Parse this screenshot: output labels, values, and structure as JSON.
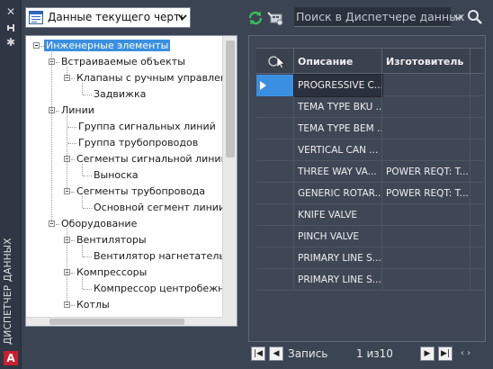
{
  "palette": {
    "title": "ДИСПЕТЧЕР ДАННЫХ",
    "close_icon": "close-icon",
    "pin_icon": "pin-icon",
    "settings_icon": "gear-icon",
    "app_logo_text": "A"
  },
  "toolbar": {
    "data_source_selected": "Данные текущего чертежа",
    "refresh_icon": "refresh-icon",
    "export_icon": "export-icon",
    "search_placeholder": "Поиск в Диспетчере данных"
  },
  "tree": {
    "nodes": [
      {
        "label": "Инженерные элементы",
        "depth": 0,
        "expandable": true,
        "selected": true
      },
      {
        "label": "Встраиваемые объекты",
        "depth": 1,
        "expandable": true
      },
      {
        "label": "Клапаны с ручным управление",
        "depth": 2,
        "expandable": true
      },
      {
        "label": "Задвижка",
        "depth": 3,
        "expandable": false
      },
      {
        "label": "Линии",
        "depth": 1,
        "expandable": true
      },
      {
        "label": "Группа сигнальных линий",
        "depth": 2,
        "expandable": false
      },
      {
        "label": "Группа трубопроводов",
        "depth": 2,
        "expandable": false
      },
      {
        "label": "Сегменты сигнальной линии",
        "depth": 2,
        "expandable": true
      },
      {
        "label": "Выноска",
        "depth": 3,
        "expandable": false
      },
      {
        "label": "Сегменты трубопровода",
        "depth": 2,
        "expandable": true
      },
      {
        "label": "Основной сегмент линии",
        "depth": 3,
        "expandable": false
      },
      {
        "label": "Оборудование",
        "depth": 1,
        "expandable": true
      },
      {
        "label": "Вентиляторы",
        "depth": 2,
        "expandable": true
      },
      {
        "label": "Вентилятор нагнетательны",
        "depth": 3,
        "expandable": false
      },
      {
        "label": "Компрессоры",
        "depth": 2,
        "expandable": true
      },
      {
        "label": "Компрессор центробежный",
        "depth": 3,
        "expandable": false
      },
      {
        "label": "Котлы",
        "depth": 2,
        "expandable": true
      }
    ]
  },
  "grid": {
    "columns": [
      "",
      "Описание",
      "Изготовитель"
    ],
    "rows": [
      {
        "description": "PROGRESSIVE C...",
        "manufacturer": ""
      },
      {
        "description": "TEMA TYPE BKU ...",
        "manufacturer": ""
      },
      {
        "description": "TEMA TYPE BEM ...",
        "manufacturer": ""
      },
      {
        "description": "VERTICAL CAN ...",
        "manufacturer": ""
      },
      {
        "description": "THREE WAY VA...",
        "manufacturer": "POWER REQT: T..."
      },
      {
        "description": "GENERIC ROTAR...",
        "manufacturer": "POWER REQT: T..."
      },
      {
        "description": "KNIFE VALVE",
        "manufacturer": ""
      },
      {
        "description": "PINCH VALVE",
        "manufacturer": ""
      },
      {
        "description": "PRIMARY LINE S...",
        "manufacturer": ""
      },
      {
        "description": "PRIMARY LINE S...",
        "manufacturer": ""
      }
    ]
  },
  "pager": {
    "label": "Запись",
    "position": "1 из10"
  },
  "colors": {
    "panel_bg": "#3b4453",
    "selection": "#3b8fe0",
    "acad_red": "#c8202f"
  }
}
